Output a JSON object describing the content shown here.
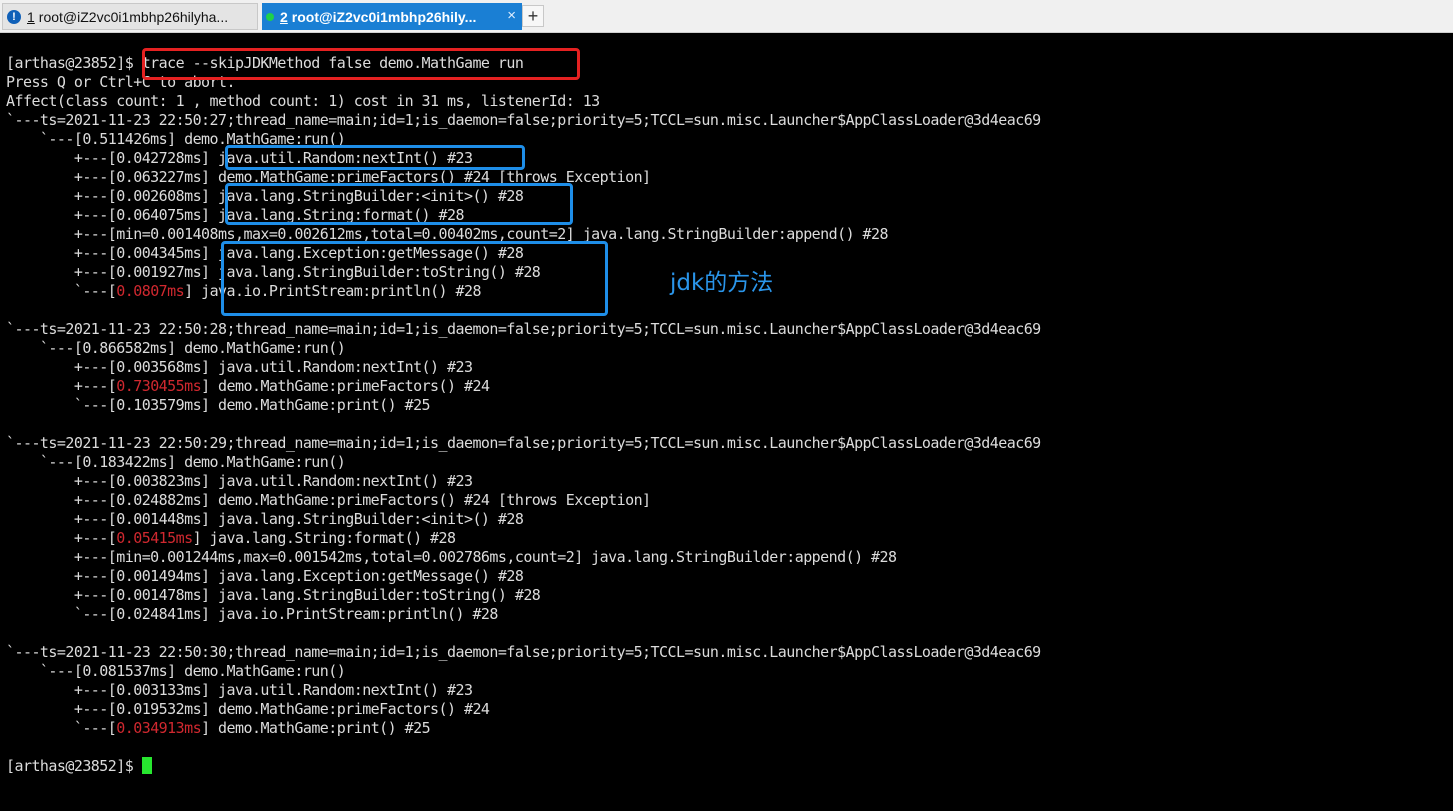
{
  "tabs": [
    {
      "number": "1",
      "title": "root@iZ2vc0i1mbhp26hilyha...",
      "status_icon": "warning-icon",
      "active": false
    },
    {
      "number": "2",
      "title": "root@iZ2vc0i1mbhp26hily...",
      "status_icon": "connected-dot-icon",
      "active": true,
      "close_label": "×"
    }
  ],
  "add_tab_label": "+",
  "annotation": "jdk的方法",
  "colors": {
    "background": "#000000",
    "text": "#dcdcdc",
    "hot": "#d0282f",
    "cursor": "#27e62f",
    "red_box": "#e52121",
    "blue_box": "#1e8ee8",
    "active_tab": "#1a7fd4"
  },
  "terminal": {
    "lines": [
      {
        "segments": [
          {
            "text": "[arthas@23852]$ trace --skipJDKMethod false demo.MathGame run"
          }
        ]
      },
      {
        "segments": [
          {
            "text": "Press Q or Ctrl+C to abort."
          }
        ]
      },
      {
        "segments": [
          {
            "text": "Affect(class count: 1 , method count: 1) cost in 31 ms, listenerId: 13"
          }
        ]
      },
      {
        "segments": [
          {
            "text": "`---ts=2021-11-23 22:50:27;thread_name=main;id=1;is_daemon=false;priority=5;TCCL=sun.misc.Launcher$AppClassLoader@3d4eac69"
          }
        ]
      },
      {
        "segments": [
          {
            "text": "    `---[0.511426ms] demo.MathGame:run()"
          }
        ]
      },
      {
        "segments": [
          {
            "text": "        +---[0.042728ms] java.util.Random:nextInt() #23"
          }
        ]
      },
      {
        "segments": [
          {
            "text": "        +---[0.063227ms] demo.MathGame:primeFactors() #24 [throws Exception]"
          }
        ]
      },
      {
        "segments": [
          {
            "text": "        +---[0.002608ms] java.lang.StringBuilder:<init>() #28"
          }
        ]
      },
      {
        "segments": [
          {
            "text": "        +---[0.064075ms] java.lang.String:format() #28"
          }
        ]
      },
      {
        "segments": [
          {
            "text": "        +---[min=0.001408ms,max=0.002612ms,total=0.00402ms,count=2] java.lang.StringBuilder:append() #28"
          }
        ]
      },
      {
        "segments": [
          {
            "text": "        +---[0.004345ms] java.lang.Exception:getMessage() #28"
          }
        ]
      },
      {
        "segments": [
          {
            "text": "        +---[0.001927ms] java.lang.StringBuilder:toString() #28"
          }
        ]
      },
      {
        "segments": [
          {
            "text": "        `---["
          },
          {
            "text": "0.0807ms",
            "hot": true
          },
          {
            "text": "] java.io.PrintStream:println() #28"
          }
        ]
      },
      {
        "segments": [
          {
            "text": ""
          }
        ]
      },
      {
        "segments": [
          {
            "text": "`---ts=2021-11-23 22:50:28;thread_name=main;id=1;is_daemon=false;priority=5;TCCL=sun.misc.Launcher$AppClassLoader@3d4eac69"
          }
        ]
      },
      {
        "segments": [
          {
            "text": "    `---[0.866582ms] demo.MathGame:run()"
          }
        ]
      },
      {
        "segments": [
          {
            "text": "        +---[0.003568ms] java.util.Random:nextInt() #23"
          }
        ]
      },
      {
        "segments": [
          {
            "text": "        +---["
          },
          {
            "text": "0.730455ms",
            "hot": true
          },
          {
            "text": "] demo.MathGame:primeFactors() #24"
          }
        ]
      },
      {
        "segments": [
          {
            "text": "        `---[0.103579ms] demo.MathGame:print() #25"
          }
        ]
      },
      {
        "segments": [
          {
            "text": ""
          }
        ]
      },
      {
        "segments": [
          {
            "text": "`---ts=2021-11-23 22:50:29;thread_name=main;id=1;is_daemon=false;priority=5;TCCL=sun.misc.Launcher$AppClassLoader@3d4eac69"
          }
        ]
      },
      {
        "segments": [
          {
            "text": "    `---[0.183422ms] demo.MathGame:run()"
          }
        ]
      },
      {
        "segments": [
          {
            "text": "        +---[0.003823ms] java.util.Random:nextInt() #23"
          }
        ]
      },
      {
        "segments": [
          {
            "text": "        +---[0.024882ms] demo.MathGame:primeFactors() #24 [throws Exception]"
          }
        ]
      },
      {
        "segments": [
          {
            "text": "        +---[0.001448ms] java.lang.StringBuilder:<init>() #28"
          }
        ]
      },
      {
        "segments": [
          {
            "text": "        +---["
          },
          {
            "text": "0.05415ms",
            "hot": true
          },
          {
            "text": "] java.lang.String:format() #28"
          }
        ]
      },
      {
        "segments": [
          {
            "text": "        +---[min=0.001244ms,max=0.001542ms,total=0.002786ms,count=2] java.lang.StringBuilder:append() #28"
          }
        ]
      },
      {
        "segments": [
          {
            "text": "        +---[0.001494ms] java.lang.Exception:getMessage() #28"
          }
        ]
      },
      {
        "segments": [
          {
            "text": "        +---[0.001478ms] java.lang.StringBuilder:toString() #28"
          }
        ]
      },
      {
        "segments": [
          {
            "text": "        `---[0.024841ms] java.io.PrintStream:println() #28"
          }
        ]
      },
      {
        "segments": [
          {
            "text": ""
          }
        ]
      },
      {
        "segments": [
          {
            "text": "`---ts=2021-11-23 22:50:30;thread_name=main;id=1;is_daemon=false;priority=5;TCCL=sun.misc.Launcher$AppClassLoader@3d4eac69"
          }
        ]
      },
      {
        "segments": [
          {
            "text": "    `---[0.081537ms] demo.MathGame:run()"
          }
        ]
      },
      {
        "segments": [
          {
            "text": "        +---[0.003133ms] java.util.Random:nextInt() #23"
          }
        ]
      },
      {
        "segments": [
          {
            "text": "        +---[0.019532ms] demo.MathGame:primeFactors() #24"
          }
        ]
      },
      {
        "segments": [
          {
            "text": "        `---["
          },
          {
            "text": "0.034913ms",
            "hot": true
          },
          {
            "text": "] demo.MathGame:print() #25"
          }
        ]
      },
      {
        "segments": [
          {
            "text": ""
          }
        ]
      },
      {
        "segments": [
          {
            "text": "[arthas@23852]$ "
          }
        ],
        "cursor": true
      }
    ]
  }
}
